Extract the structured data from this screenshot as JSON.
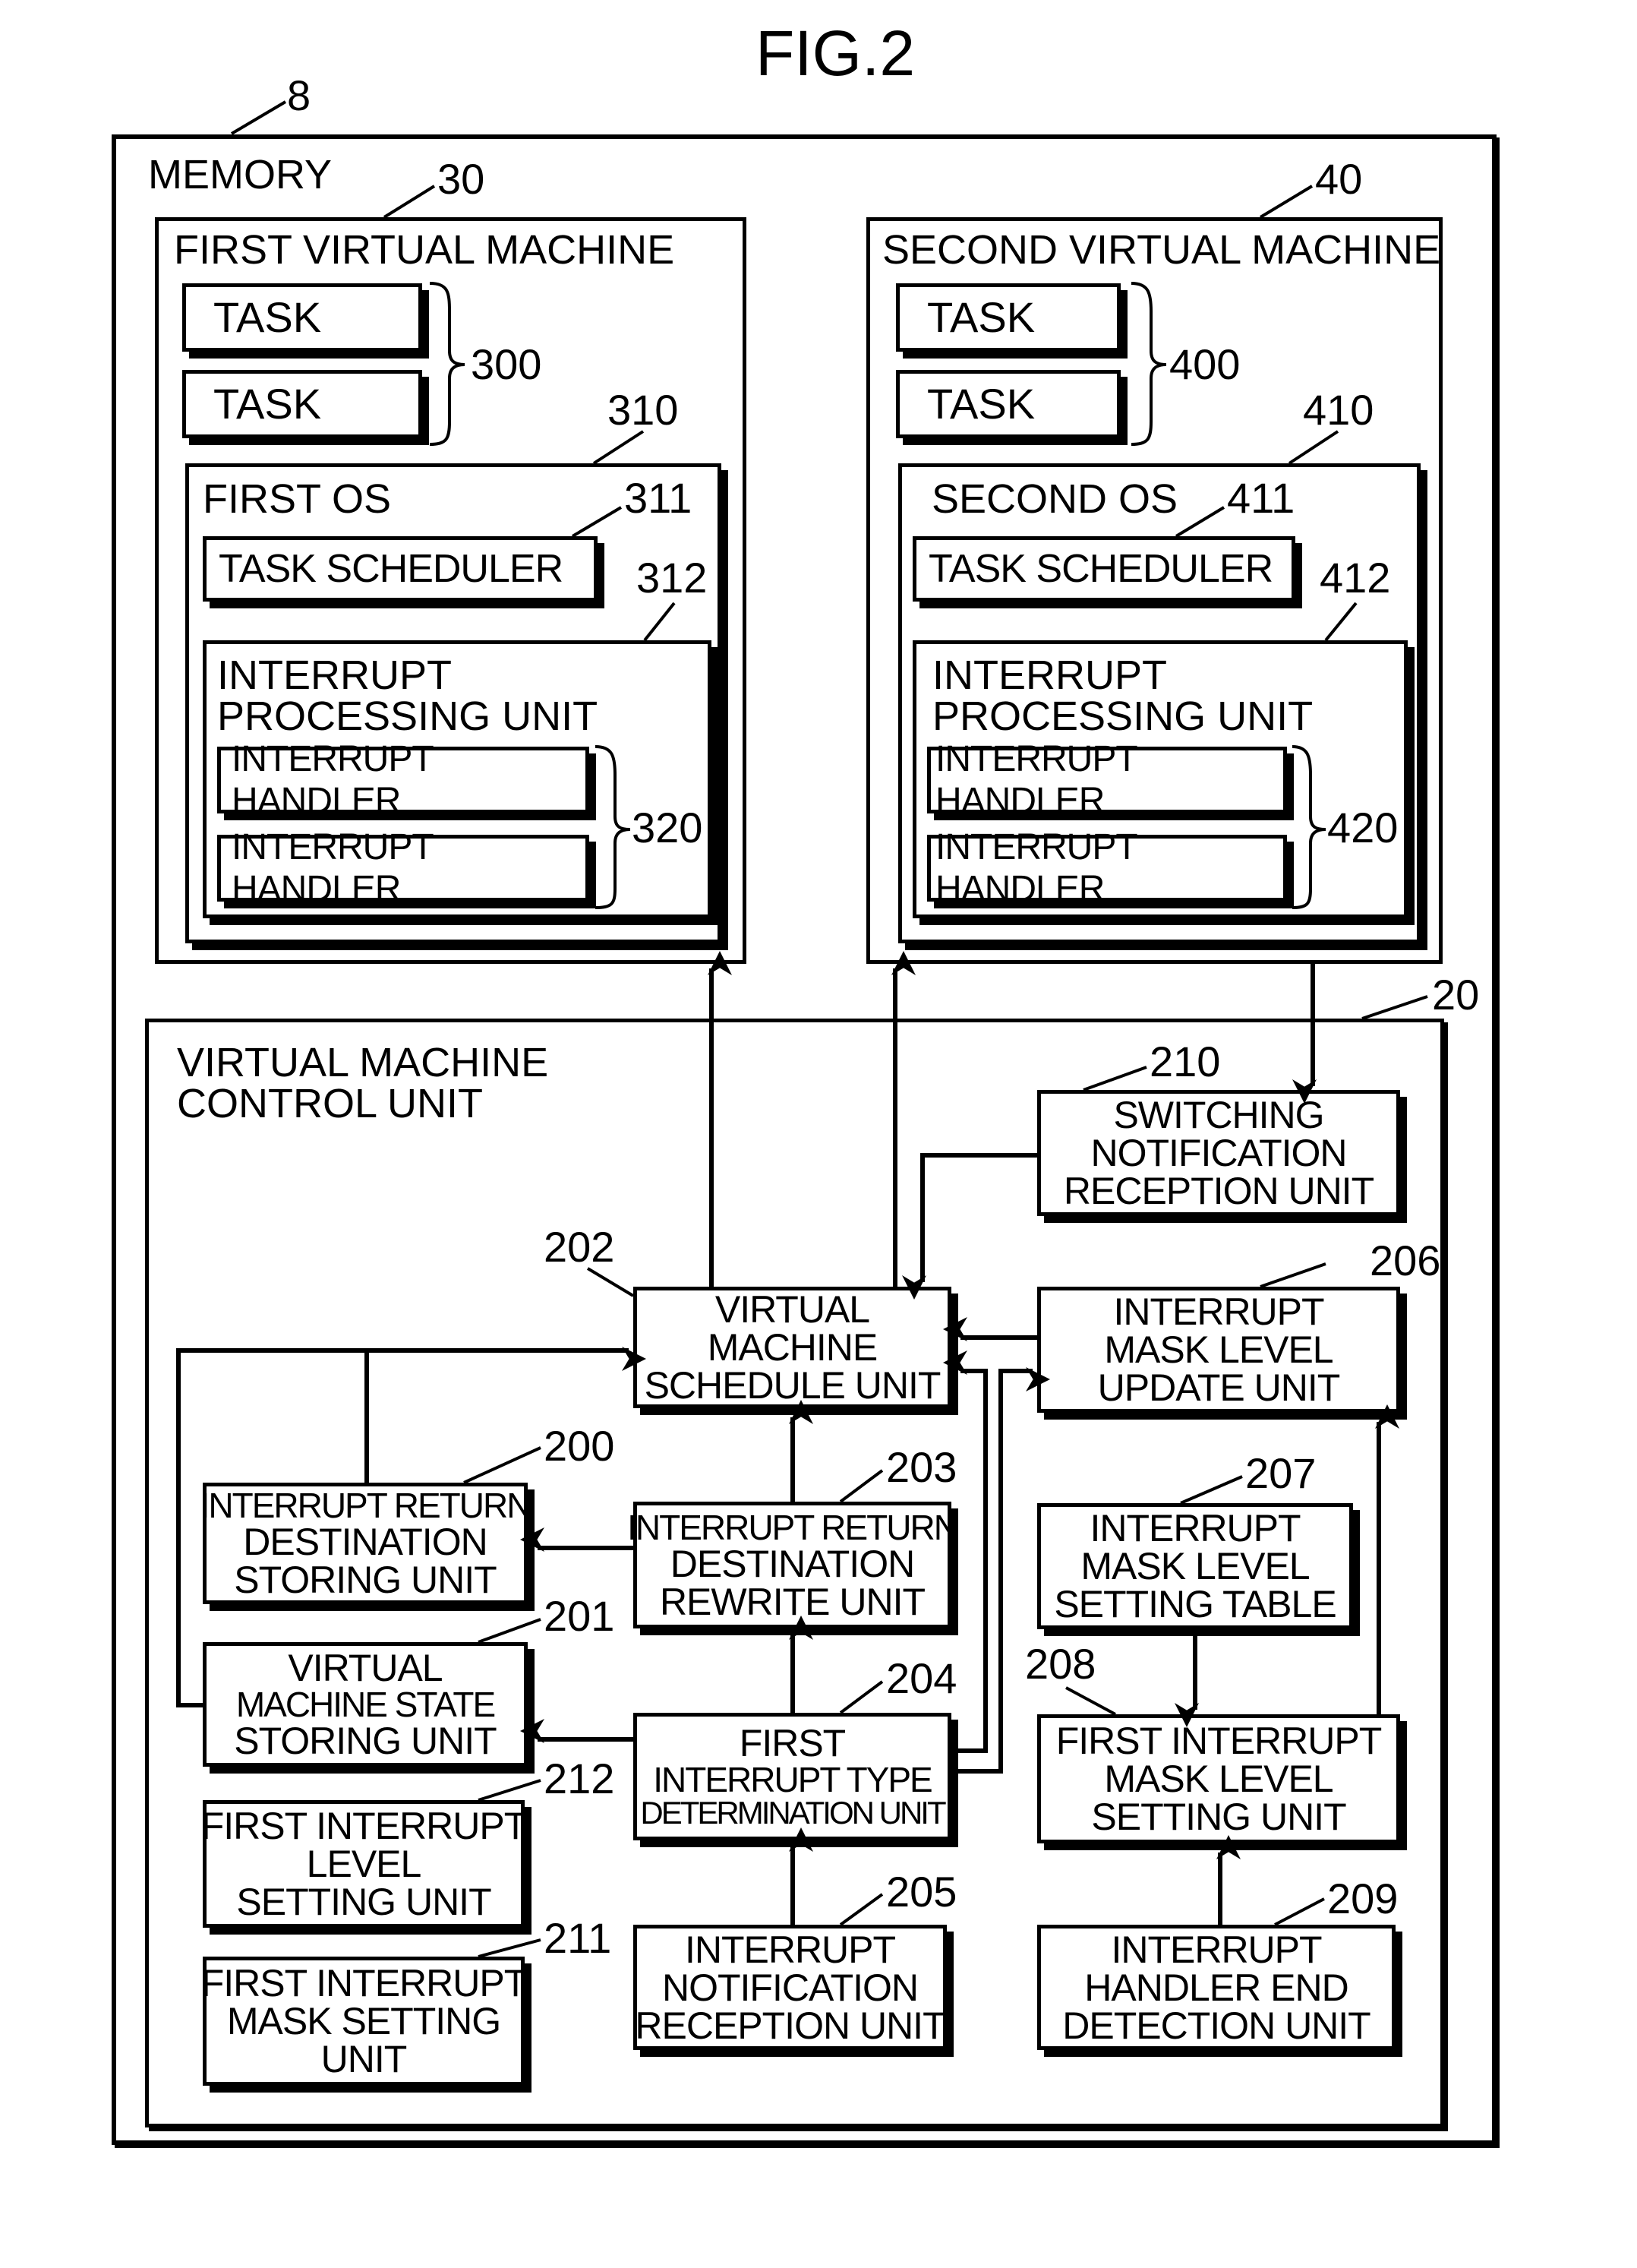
{
  "figure": {
    "title": "FIG.2"
  },
  "memory": {
    "ref": "8",
    "label": "MEMORY"
  },
  "first_vm": {
    "ref": "30",
    "label": "FIRST VIRTUAL MACHINE",
    "tasks": [
      "TASK",
      "TASK"
    ],
    "tasks_ref": "300",
    "os": {
      "ref": "310",
      "label": "FIRST OS",
      "task_scheduler": {
        "ref": "311",
        "label": "TASK SCHEDULER"
      },
      "interrupt_processing_unit": {
        "ref": "312",
        "label_lines": [
          "INTERRUPT",
          "PROCESSING UNIT"
        ],
        "handlers": [
          "INTERRUPT HANDLER",
          "INTERRUPT HANDLER"
        ],
        "handlers_ref": "320"
      }
    }
  },
  "second_vm": {
    "ref": "40",
    "label": "SECOND VIRTUAL MACHINE",
    "tasks": [
      "TASK",
      "TASK"
    ],
    "tasks_ref": "400",
    "os": {
      "ref": "410",
      "label": "SECOND OS",
      "task_scheduler": {
        "ref": "411",
        "label": "TASK SCHEDULER"
      },
      "interrupt_processing_unit": {
        "ref": "412",
        "label_lines": [
          "INTERRUPT",
          "PROCESSING UNIT"
        ],
        "handlers": [
          "INTERRUPT HANDLER",
          "INTERRUPT HANDLER"
        ],
        "handlers_ref": "420"
      }
    }
  },
  "vm_control_unit": {
    "ref": "20",
    "label_lines": [
      "VIRTUAL MACHINE",
      "CONTROL UNIT"
    ],
    "units": {
      "u200": {
        "ref": "200",
        "lines": [
          "INTERRUPT RETURN",
          "DESTINATION",
          "STORING UNIT"
        ]
      },
      "u201": {
        "ref": "201",
        "lines": [
          "VIRTUAL",
          "MACHINE STATE",
          "STORING UNIT"
        ]
      },
      "u202": {
        "ref": "202",
        "lines": [
          "VIRTUAL",
          "MACHINE",
          "SCHEDULE UNIT"
        ]
      },
      "u203": {
        "ref": "203",
        "lines": [
          "INTERRUPT RETURN",
          "DESTINATION",
          "REWRITE UNIT"
        ]
      },
      "u204": {
        "ref": "204",
        "lines": [
          "FIRST",
          "INTERRUPT TYPE",
          "DETERMINATION UNIT"
        ]
      },
      "u205": {
        "ref": "205",
        "lines": [
          "INTERRUPT",
          "NOTIFICATION",
          "RECEPTION UNIT"
        ]
      },
      "u206": {
        "ref": "206",
        "lines": [
          "INTERRUPT",
          "MASK LEVEL",
          "UPDATE UNIT"
        ]
      },
      "u207": {
        "ref": "207",
        "lines": [
          "INTERRUPT",
          "MASK LEVEL",
          "SETTING TABLE"
        ]
      },
      "u208": {
        "ref": "208",
        "lines": [
          "FIRST INTERRUPT",
          "MASK LEVEL",
          "SETTING UNIT"
        ]
      },
      "u209": {
        "ref": "209",
        "lines": [
          "INTERRUPT",
          "HANDLER END",
          "DETECTION UNIT"
        ]
      },
      "u210": {
        "ref": "210",
        "lines": [
          "SWITCHING",
          "NOTIFICATION",
          "RECEPTION UNIT"
        ]
      },
      "u211": {
        "ref": "211",
        "lines": [
          "FIRST INTERRUPT",
          "MASK SETTING",
          "UNIT"
        ]
      },
      "u212": {
        "ref": "212",
        "lines": [
          "FIRST INTERRUPT",
          "LEVEL",
          "SETTING UNIT"
        ]
      }
    }
  }
}
